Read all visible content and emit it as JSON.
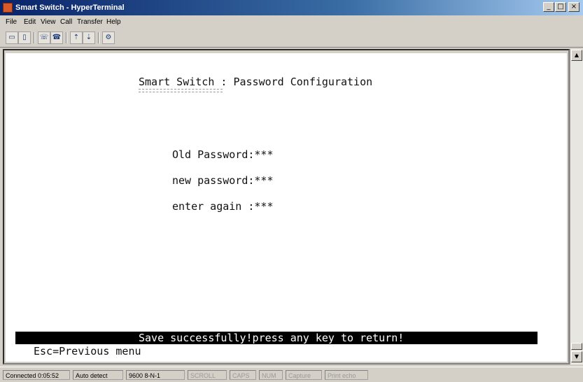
{
  "window": {
    "title": "Smart Switch - HyperTerminal",
    "minimize": "_",
    "maximize": "□",
    "close": "×"
  },
  "menu": [
    "File",
    "Edit",
    "View",
    "Call",
    "Transfer",
    "Help"
  ],
  "toolbar": {
    "icons": [
      "new-connection-icon",
      "open-icon",
      "call-icon",
      "disconnect-icon",
      "send-icon",
      "receive-icon",
      "properties-icon"
    ],
    "glyphs": [
      "▭",
      "▯",
      "☏",
      "☎",
      "⇡",
      "⇣",
      "⚙"
    ]
  },
  "terminal": {
    "heading": "Smart Switch : Password Configuration",
    "old_password": "Old Password:***",
    "new_password": "new password:***",
    "enter_again": "enter again :***",
    "status_message": "Save successfully!press any key to return!",
    "footer": "Esc=Previous menu"
  },
  "statusbar": {
    "connected": "Connected 0:05:52",
    "detect": "Auto detect",
    "settings": "9600 8-N-1",
    "scroll": "SCROLL",
    "caps": "CAPS",
    "num": "NUM",
    "capture": "Capture",
    "echo": "Print echo"
  }
}
